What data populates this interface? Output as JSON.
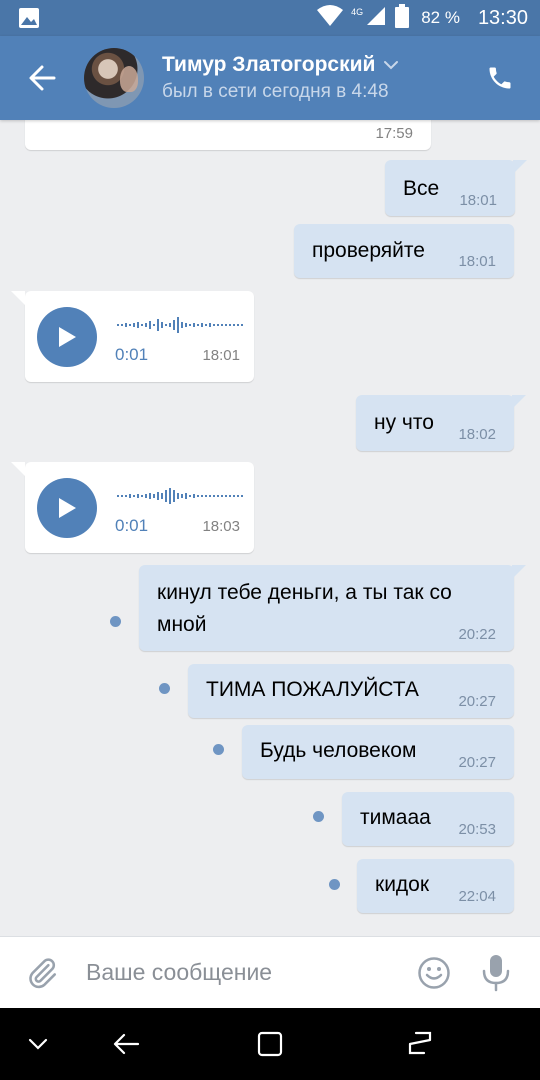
{
  "status_bar": {
    "network": "4G",
    "battery": "82 %",
    "time": "13:30",
    "icons": [
      "gallery-icon",
      "wifi-icon",
      "signal-icon",
      "battery-icon"
    ]
  },
  "header": {
    "contact_name": "Тимур Златогорский",
    "contact_status": "был в сети сегодня в 4:48"
  },
  "messages": [
    {
      "id": "m0",
      "direction": "in",
      "type": "text",
      "text": "",
      "time": "17:59"
    },
    {
      "id": "m1",
      "direction": "out",
      "type": "text",
      "text": "Все",
      "time": "18:01"
    },
    {
      "id": "m2",
      "direction": "out",
      "type": "text",
      "text": "проверяйте",
      "time": "18:01"
    },
    {
      "id": "m3",
      "direction": "in",
      "type": "voice",
      "duration": "0:01",
      "time": "18:01"
    },
    {
      "id": "m4",
      "direction": "out",
      "type": "text",
      "text": "ну что",
      "time": "18:02"
    },
    {
      "id": "m5",
      "direction": "in",
      "type": "voice",
      "duration": "0:01",
      "time": "18:03"
    },
    {
      "id": "m6",
      "direction": "out",
      "type": "text",
      "text_line1": "кинул тебе деньги, а ты так со",
      "text_line2": "мной",
      "time": "20:22",
      "unread": true
    },
    {
      "id": "m7",
      "direction": "out",
      "type": "text",
      "text": "ТИМА ПОЖАЛУЙСТА",
      "time": "20:27",
      "unread": true
    },
    {
      "id": "m8",
      "direction": "out",
      "type": "text",
      "text": "Будь человеком",
      "time": "20:27",
      "unread": true
    },
    {
      "id": "m9",
      "direction": "out",
      "type": "text",
      "text": "тимааа",
      "time": "20:53",
      "unread": true
    },
    {
      "id": "m10",
      "direction": "out",
      "type": "text",
      "text": "кидок",
      "time": "22:04",
      "unread": true
    }
  ],
  "input": {
    "placeholder": "Ваше сообщение",
    "value": ""
  },
  "colors": {
    "header": "#5181b8",
    "status_bar": "#4a76a8",
    "outgoing_bubble": "#d6e3f2",
    "incoming_bubble": "#ffffff",
    "chat_background": "#edeef0",
    "accent": "#5181b8"
  }
}
